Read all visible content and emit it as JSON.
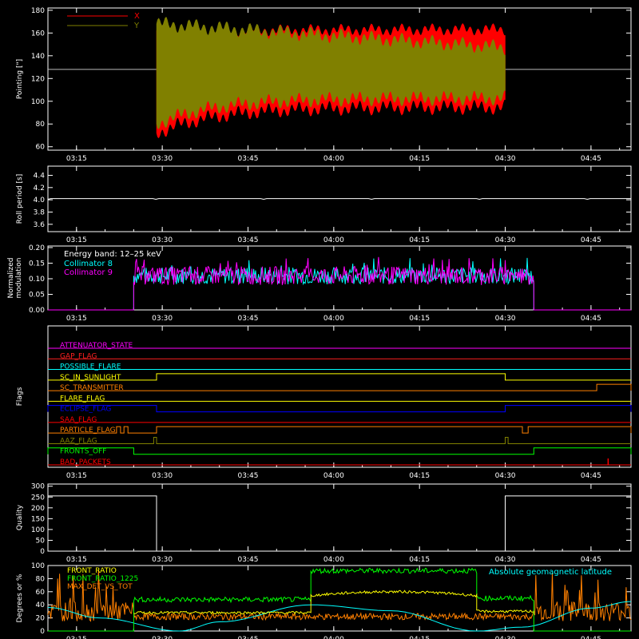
{
  "colors": {
    "background": "#000000",
    "axis": "#ffffff",
    "x_pointing": "#ff0000",
    "y_pointing": "#808000",
    "collimator8": "#00ffff",
    "collimator9": "#ff00ff",
    "front_ratio": "#ffff00",
    "front_ratio_1225": "#00ff00",
    "max_det_vs_tot": "#ff8000",
    "geomag": "#00ffff"
  },
  "time_axis": {
    "min": "03:10",
    "max": "04:52",
    "ticks": [
      "03:15",
      "03:30",
      "03:45",
      "04:00",
      "04:15",
      "04:30",
      "04:45"
    ]
  },
  "chart_data": [
    {
      "id": "pointing",
      "type": "area",
      "ylabel": "Pointing [\"]",
      "ylim": [
        57,
        182
      ],
      "yticks": [
        60,
        80,
        100,
        120,
        140,
        160,
        180
      ],
      "reference_line": 128,
      "legend": [
        {
          "name": "X",
          "color": "#ff0000"
        },
        {
          "name": "Y",
          "color": "#808000"
        }
      ],
      "series": [
        {
          "name": "X",
          "start": "03:29",
          "end": "04:30",
          "lower_start": 72,
          "lower_end": 95,
          "upper_start": 162,
          "upper_end": 163
        },
        {
          "name": "Y",
          "start": "03:29",
          "end": "04:30",
          "lower_start": 80,
          "lower_end": 103,
          "upper_start": 168,
          "upper_end": 147
        }
      ]
    },
    {
      "id": "roll_period",
      "type": "line",
      "ylabel": "Roll period [s]",
      "ylim": [
        3.48,
        4.55
      ],
      "yticks": [
        "3.6",
        "3.8",
        "4.0",
        "4.2",
        "4.4"
      ],
      "series": [
        {
          "name": "",
          "x": [
            "03:10",
            "04:52"
          ],
          "y": [
            4.02,
            4.02
          ]
        }
      ]
    },
    {
      "id": "modulation",
      "type": "line",
      "ylabel": "Normalized modulation",
      "ylim": [
        0,
        0.205
      ],
      "yticks": [
        "0.00",
        "0.05",
        "0.10",
        "0.15",
        "0.20"
      ],
      "annotation": "Energy band: 12–25 keV",
      "legend": [
        {
          "name": "Collimator 8",
          "color": "#00ffff"
        },
        {
          "name": "Collimator 9",
          "color": "#ff00ff"
        }
      ],
      "active_start": "03:25",
      "active_end": "04:35",
      "mean": 0.11
    },
    {
      "id": "flags",
      "type": "line",
      "ylabel": "Flags",
      "rows": [
        {
          "name": "ATTENUATOR_STATE",
          "color": "#ff00ff",
          "on": []
        },
        {
          "name": "GAP_FLAG",
          "color": "#ff2020",
          "on": []
        },
        {
          "name": "POSSIBLE_FLARE",
          "color": "#00ffff",
          "on": []
        },
        {
          "name": "SC_IN_SUNLIGHT",
          "color": "#ffff00",
          "on": [
            [
              "03:29",
              "04:30"
            ]
          ]
        },
        {
          "name": "SC_TRANSMITTER",
          "color": "#ff8000",
          "on": [
            [
              "04:46",
              "04:52"
            ]
          ]
        },
        {
          "name": "FLARE_FLAG",
          "color": "#ffff00",
          "on": []
        },
        {
          "name": "ECLIPSE_FLAG",
          "color": "#0000ff",
          "on": [
            [
              "03:10",
              "03:29"
            ],
            [
              "04:30",
              "04:52"
            ]
          ]
        },
        {
          "name": "SAA_FLAG",
          "color": "#ff0000",
          "on": []
        },
        {
          "name": "PARTICLE_FLAG",
          "color": "#ff8000",
          "on": [
            [
              "03:22",
              "03:22.7"
            ],
            [
              "03:23.3",
              "03:24"
            ],
            [
              "03:29",
              "04:33"
            ],
            [
              "04:34",
              "04:52"
            ]
          ]
        },
        {
          "name": "AAZ_FLAG",
          "color": "#808000",
          "on": [
            [
              "03:28.5",
              "03:29"
            ],
            [
              "04:30",
              "04:30.5"
            ]
          ]
        },
        {
          "name": "FRONTS_OFF",
          "color": "#00ff00",
          "on": [
            [
              "03:10",
              "03:25"
            ],
            [
              "04:35",
              "04:52"
            ]
          ]
        },
        {
          "name": "BAD_PACKETS",
          "color": "#ff0000",
          "on": []
        }
      ]
    },
    {
      "id": "quality",
      "type": "line",
      "ylabel": "Quality",
      "ylim": [
        0,
        310
      ],
      "yticks": [
        "0",
        "50",
        "100",
        "150",
        "200",
        "250",
        "300"
      ],
      "series": [
        {
          "name": "",
          "x": [
            "03:10",
            "03:29",
            "03:29",
            "04:30",
            "04:30",
            "04:52"
          ],
          "y": [
            255,
            255,
            0,
            0,
            255,
            255
          ]
        }
      ]
    },
    {
      "id": "ratios",
      "type": "line",
      "ylabel": "Degrees or %",
      "ylim": [
        0,
        100
      ],
      "yticks": [
        "0",
        "20",
        "40",
        "60",
        "80",
        "100"
      ],
      "legend_left": [
        {
          "name": "FRONT_RATIO",
          "color": "#ffff00"
        },
        {
          "name": "FRONT_RATIO_1225",
          "color": "#00ff00"
        },
        {
          "name": "MAX_DET_VS_TOT",
          "color": "#ff8000"
        }
      ],
      "legend_right": {
        "name": "Absolute geomagnetic latitude",
        "color": "#00ffff"
      },
      "series": [
        {
          "name": "FRONT_RATIO_1225",
          "segments": [
            [
              "03:10",
              "03:25",
              0
            ],
            [
              "03:25",
              "03:56",
              48
            ],
            [
              "03:56",
              "04:25",
              92
            ],
            [
              "04:25",
              "04:35",
              50
            ],
            [
              "04:35",
              "04:52",
              0
            ]
          ]
        },
        {
          "name": "FRONT_RATIO",
          "segments": [
            [
              "03:25",
              "03:56",
              28
            ],
            [
              "03:56",
              "04:25",
              60
            ],
            [
              "04:25",
              "04:35",
              30
            ]
          ]
        },
        {
          "name": "MAX_DET_VS_TOT",
          "mean": 25
        },
        {
          "name": "Absolute geomagnetic latitude",
          "x": [
            "03:10",
            "03:19",
            "03:33",
            "03:40",
            "03:56",
            "04:10",
            "04:25",
            "04:33",
            "04:45",
            "04:52"
          ],
          "y": [
            36,
            20,
            0,
            14,
            40,
            31,
            0,
            6,
            35,
            45
          ]
        }
      ]
    }
  ]
}
